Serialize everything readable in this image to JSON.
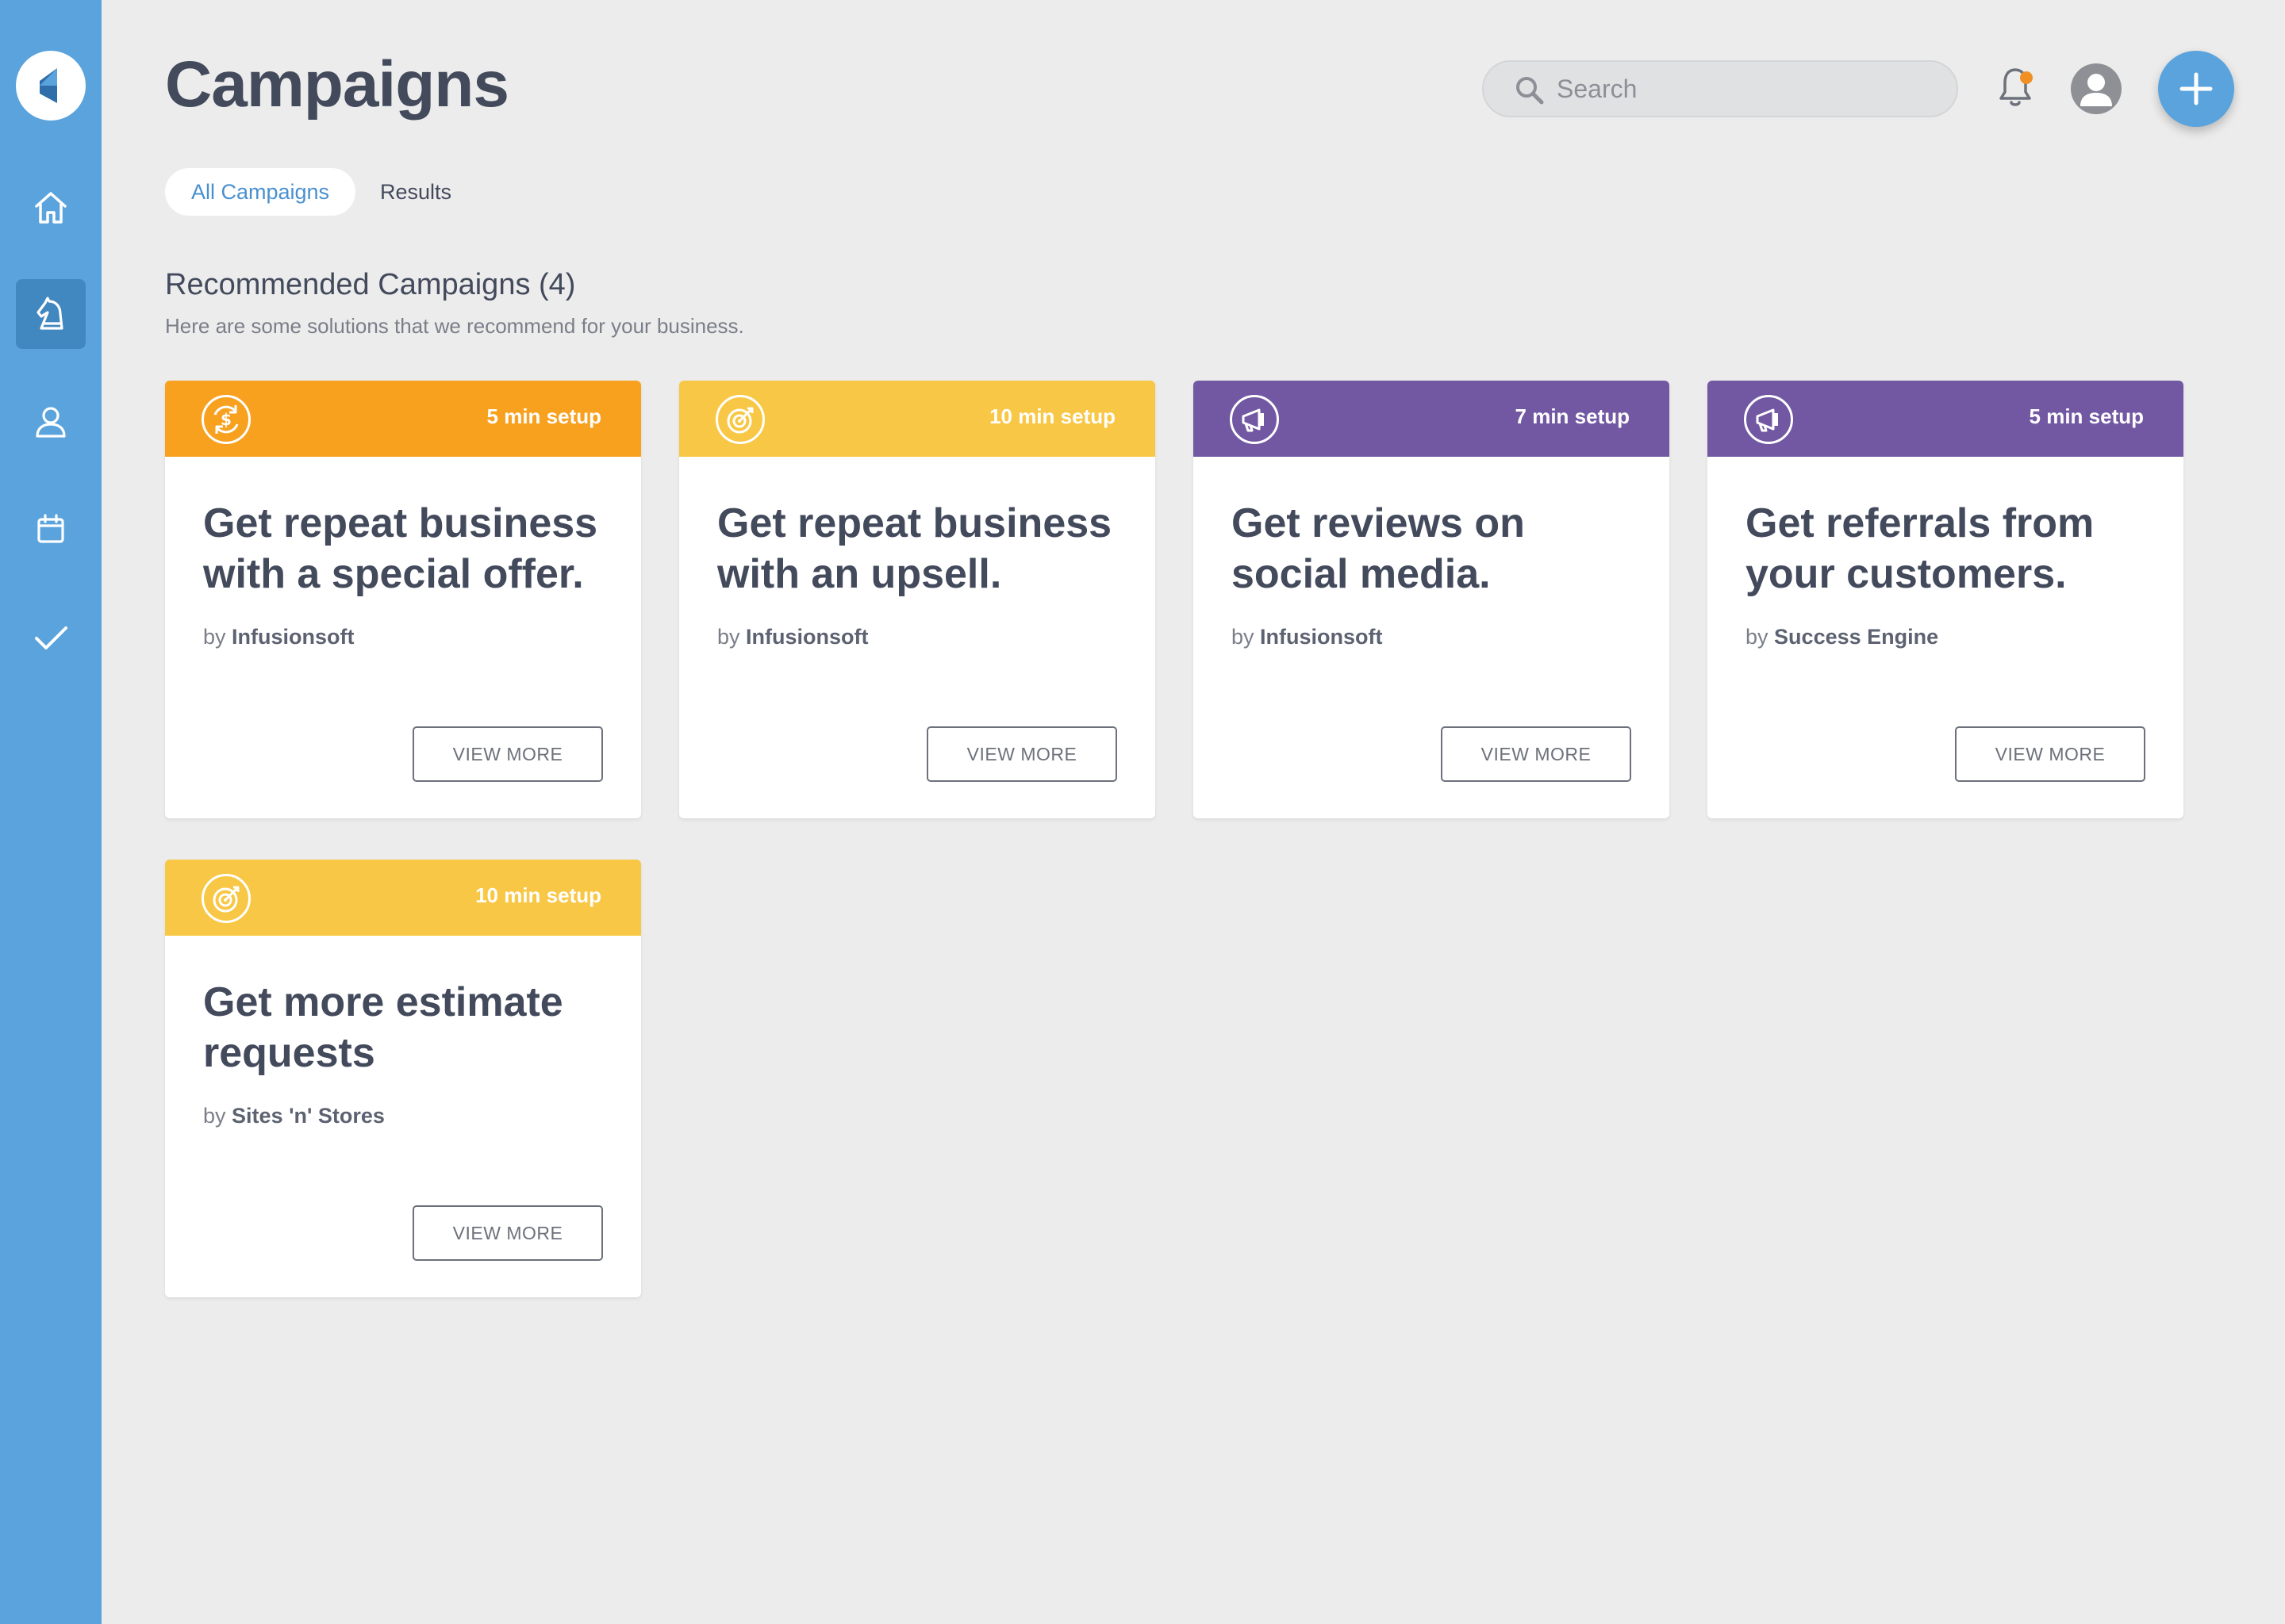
{
  "app": {
    "title": "Campaigns"
  },
  "nav": {
    "items": [
      {
        "icon": "home-icon",
        "active": false
      },
      {
        "icon": "chess-knight-icon",
        "active": true
      },
      {
        "icon": "contact-icon",
        "active": false
      },
      {
        "icon": "calendar-icon",
        "active": false
      },
      {
        "icon": "checkmark-icon",
        "active": false
      }
    ]
  },
  "header": {
    "search_placeholder": "Search"
  },
  "tabs": [
    {
      "label": "All Campaigns",
      "active": true
    },
    {
      "label": "Results",
      "active": false
    }
  ],
  "section": {
    "title": "Recommended Campaigns (4)",
    "subtitle": "Here are some solutions that we recommend for your business."
  },
  "cards": [
    {
      "icon": "repeat-dollar-icon",
      "color": "#f7a11f",
      "setup": "5 min setup",
      "title": "Get repeat business with a special offer.",
      "by_prefix": "by",
      "author": "Infusionsoft",
      "button": "VIEW MORE"
    },
    {
      "icon": "target-icon",
      "color": "#f8c745",
      "setup": "10 min setup",
      "title": "Get repeat business with an upsell.",
      "by_prefix": "by",
      "author": "Infusionsoft",
      "button": "VIEW MORE"
    },
    {
      "icon": "megaphone-icon",
      "color": "#7258a3",
      "setup": "7 min setup",
      "title": "Get reviews on social media.",
      "by_prefix": "by",
      "author": "Infusionsoft",
      "button": "VIEW MORE"
    },
    {
      "icon": "megaphone-icon",
      "color": "#7258a3",
      "setup": "5 min setup",
      "title": "Get referrals from your customers.",
      "by_prefix": "by",
      "author": "Success Engine",
      "button": "VIEW MORE"
    },
    {
      "icon": "target-icon",
      "color": "#f8c745",
      "setup": "10 min setup",
      "title": "Get more estimate requests",
      "by_prefix": "by",
      "author": "Sites 'n' Stores",
      "button": "VIEW MORE"
    }
  ],
  "colors": {
    "sidebar": "#5aa3dc",
    "sidebar_active": "#4187c0",
    "accent": "#5aa3dc",
    "notification_dot": "#f08f24"
  }
}
